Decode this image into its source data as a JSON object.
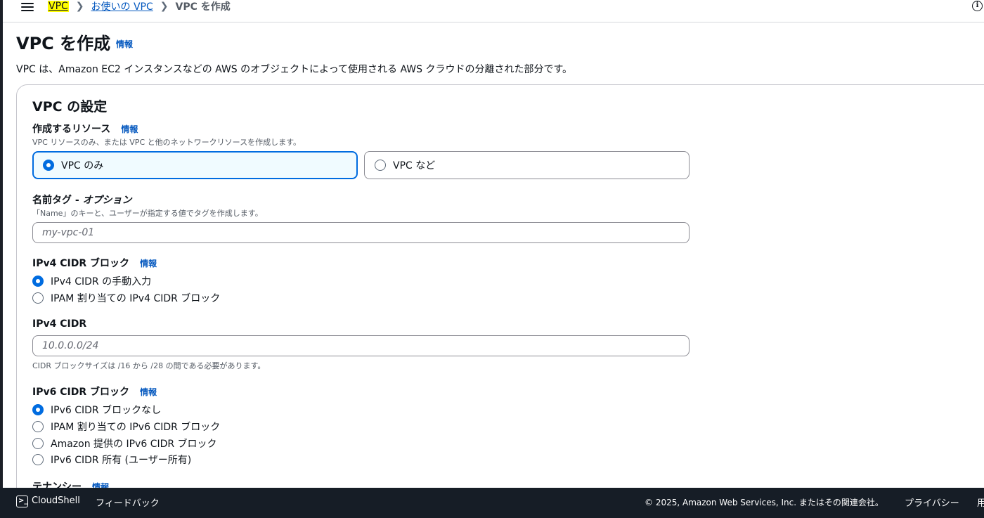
{
  "breadcrumb": {
    "root": "VPC",
    "middle": "お使いの VPC",
    "current": "VPC を作成"
  },
  "page": {
    "title": "VPC を作成",
    "title_info": "情報",
    "description": "VPC は、Amazon EC2 インスタンスなどの AWS のオブジェクトによって使用される AWS クラウドの分離された部分です。"
  },
  "settings": {
    "section_title": "VPC の設定",
    "resources": {
      "label": "作成するリソース",
      "info": "情報",
      "description": "VPC リソースのみ、または VPC と他のネットワークリソースを作成します。",
      "options": [
        {
          "label": "VPC のみ",
          "selected": true
        },
        {
          "label": "VPC など",
          "selected": false
        }
      ]
    },
    "name_tag": {
      "label_main": "名前タグ - ",
      "label_opt": "オプション",
      "description": "「Name」のキーと、ユーザーが指定する値でタグを作成します。",
      "placeholder": "my-vpc-01"
    },
    "ipv4_block": {
      "label": "IPv4 CIDR ブロック",
      "info": "情報",
      "options": [
        {
          "label": "IPv4 CIDR の手動入力",
          "selected": true
        },
        {
          "label": "IPAM 割り当ての IPv4 CIDR ブロック",
          "selected": false
        }
      ]
    },
    "ipv4_cidr": {
      "label": "IPv4 CIDR",
      "placeholder": "10.0.0.0/24",
      "hint": "CIDR ブロックサイズは /16 から /28 の間である必要があります。"
    },
    "ipv6_block": {
      "label": "IPv6 CIDR ブロック",
      "info": "情報",
      "options": [
        {
          "label": "IPv6 CIDR ブロックなし",
          "selected": true
        },
        {
          "label": "IPAM 割り当ての IPv6 CIDR ブロック",
          "selected": false
        },
        {
          "label": "Amazon 提供の IPv6 CIDR ブロック",
          "selected": false
        },
        {
          "label": "IPv6 CIDR 所有 (ユーザー所有)",
          "selected": false
        }
      ]
    },
    "tenancy": {
      "label": "テナンシー",
      "info": "情報"
    }
  },
  "footer": {
    "cloudshell": "CloudShell",
    "feedback": "フィードバック",
    "copyright": "© 2025, Amazon Web Services, Inc. またはその関連会社。",
    "privacy": "プライバシー",
    "terms": "用"
  },
  "colors": {
    "accent": "#006ce0",
    "link": "#0458bf",
    "footer_bg": "#161d26",
    "highlight": "#fdfc00"
  }
}
